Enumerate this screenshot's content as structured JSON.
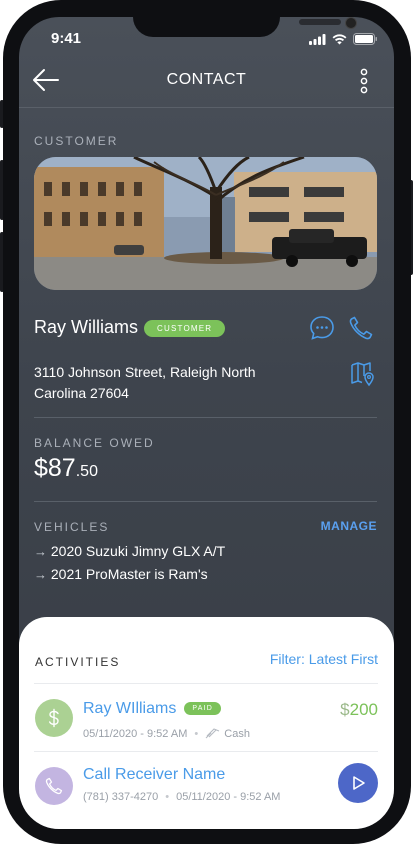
{
  "status_bar": {
    "time": "9:41"
  },
  "header": {
    "title": "CONTACT",
    "back_icon": "arrow-left-icon",
    "menu_icon": "more-vertical-icon"
  },
  "customer": {
    "section_label": "CUSTOMER",
    "name": "Ray Williams",
    "badge": "CUSTOMER",
    "address": "3110 Johnson Street, Raleigh North Carolina 27604",
    "icons": [
      "chat-icon",
      "phone-icon",
      "map-icon"
    ]
  },
  "balance": {
    "label": "BALANCE OWED",
    "currency": "$",
    "dollars": "87",
    "cents": ".50"
  },
  "vehicles": {
    "label": "VEHICLES",
    "manage_label": "MANAGE",
    "items": [
      "2020 Suzuki Jimny GLX A/T",
      "2021 ProMaster is Ram's"
    ]
  },
  "activities": {
    "title": "ACTIVITIES",
    "filter_label": "Filter: Latest First",
    "items": [
      {
        "name": "Ray WIlliams",
        "badge": "PAID",
        "date": "05/11/2020 - 9:52 AM",
        "method": "Cash",
        "currency": "$",
        "amount": "200",
        "icon": "dollar-icon",
        "accent": "#8fc26f"
      },
      {
        "name": "Call Receiver Name",
        "phone": "(781) 337-4270",
        "date": "05/11/2020 - 9:52 AM",
        "icon": "phone-icon",
        "action_icon": "play-icon",
        "accent": "#b9a8dc"
      }
    ]
  },
  "colors": {
    "accent_blue": "#4a9be8",
    "green": "#7cc25a",
    "play": "#4d67c8",
    "screen_bg": "#40464f"
  }
}
